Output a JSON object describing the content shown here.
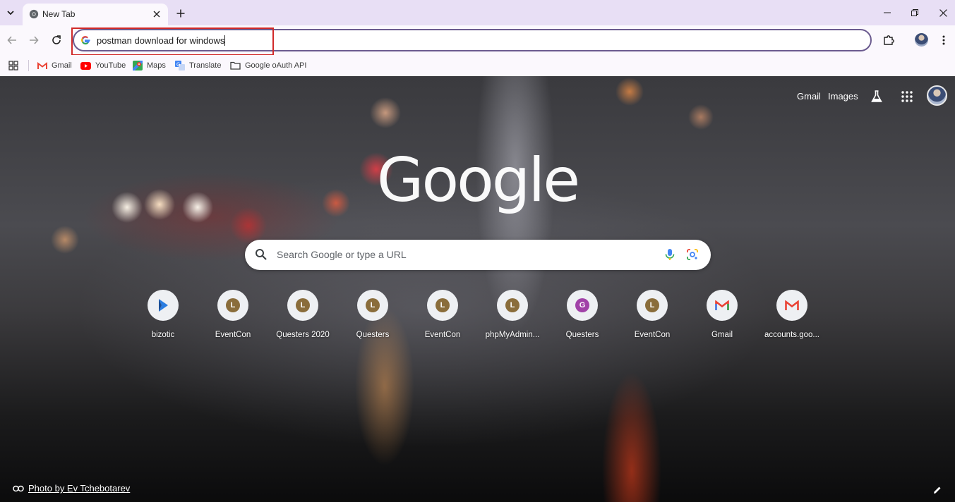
{
  "tab": {
    "title": "New Tab"
  },
  "omnibox": {
    "value": "postman download for windows"
  },
  "bookmarks": [
    {
      "label": "Gmail",
      "icon": "gmail-icon"
    },
    {
      "label": "YouTube",
      "icon": "youtube-icon"
    },
    {
      "label": "Maps",
      "icon": "maps-icon"
    },
    {
      "label": "Translate",
      "icon": "translate-icon"
    },
    {
      "label": "Google oAuth API",
      "icon": "folder-icon"
    }
  ],
  "ntp": {
    "top_links": {
      "gmail": "Gmail",
      "images": "Images"
    },
    "logo": "Google",
    "search": {
      "placeholder": "Search Google or type a URL"
    },
    "shortcuts": [
      {
        "label": "bizotic",
        "letter": "",
        "icon": "bizotic-icon",
        "color": "#2a7de1"
      },
      {
        "label": "EventCon",
        "letter": "L",
        "icon": "letter-icon",
        "color": "#8a6d3b"
      },
      {
        "label": "Questers 2020",
        "letter": "L",
        "icon": "letter-icon",
        "color": "#8a6d3b"
      },
      {
        "label": "Questers",
        "letter": "L",
        "icon": "letter-icon",
        "color": "#8a6d3b"
      },
      {
        "label": "EventCon",
        "letter": "L",
        "icon": "letter-icon",
        "color": "#8a6d3b"
      },
      {
        "label": "phpMyAdmin...",
        "letter": "L",
        "icon": "letter-icon",
        "color": "#8a6d3b"
      },
      {
        "label": "Questers",
        "letter": "G",
        "icon": "letter-icon",
        "color": "#a142a8"
      },
      {
        "label": "EventCon",
        "letter": "L",
        "icon": "letter-icon",
        "color": "#8a6d3b"
      },
      {
        "label": "Gmail",
        "letter": "",
        "icon": "gmail-icon",
        "color": "#ea4335"
      },
      {
        "label": "accounts.goo...",
        "letter": "",
        "icon": "gmail-icon",
        "color": "#ea4335"
      }
    ],
    "attribution": "Photo by Ev Tchebotarev"
  }
}
